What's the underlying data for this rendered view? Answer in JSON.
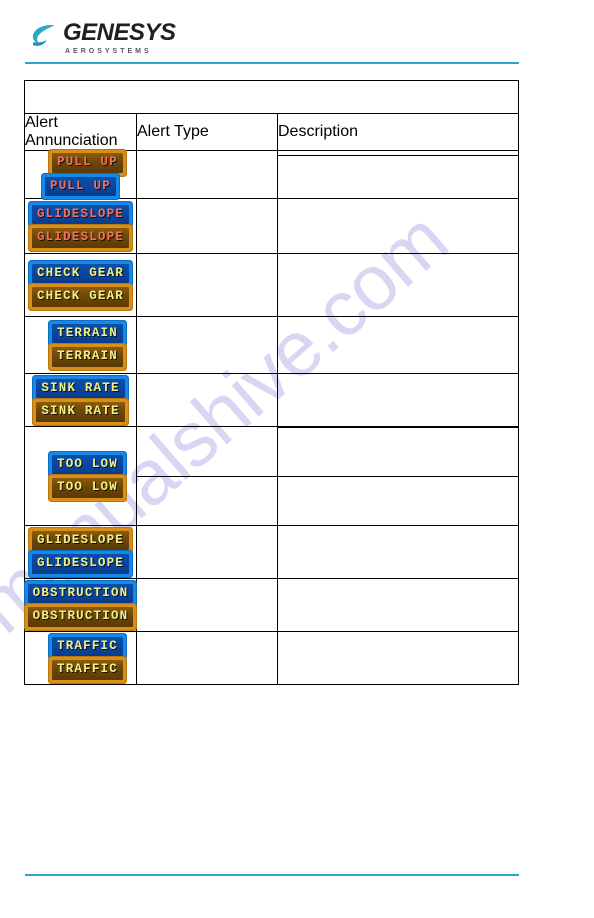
{
  "document": {
    "page_background": "#ffffff",
    "rule_color": "#29a8c9",
    "watermark_text": "manualshive.com"
  },
  "header": {
    "logo_name": "GENESYS",
    "logo_subtitle": "AEROSYSTEMS",
    "logo_icon": "swoosh-icon"
  },
  "table": {
    "columns": [
      "Alert Annunciation",
      "Alert Type",
      "Description"
    ],
    "header_row_label": "",
    "rows": [
      {
        "id": "pull-up",
        "badges": [
          {
            "text": "PULL UP",
            "style": "amber",
            "text_color": "#f2705e"
          },
          {
            "text": "PULL UP",
            "style": "blue",
            "text_color": "#f2705e"
          }
        ],
        "cells": [
          "",
          ""
        ]
      },
      {
        "id": "glideslope-1",
        "badges": [
          {
            "text": "GLIDESLOPE",
            "style": "blue",
            "text_color": "#f2705e"
          },
          {
            "text": "GLIDESLOPE",
            "style": "amber",
            "text_color": "#f2705e"
          }
        ],
        "cells": [
          "",
          ""
        ]
      },
      {
        "id": "check-gear",
        "badges": [
          {
            "text": "CHECK GEAR",
            "style": "blue",
            "text_color": "#f2ef86"
          },
          {
            "text": "CHECK GEAR",
            "style": "amber",
            "text_color": "#f2ef86"
          }
        ],
        "cells": [
          "",
          ""
        ]
      },
      {
        "id": "terrain",
        "badges": [
          {
            "text": "TERRAIN",
            "style": "blue",
            "text_color": "#f2ef86"
          },
          {
            "text": "TERRAIN",
            "style": "amber",
            "text_color": "#f2ef86"
          }
        ],
        "cells": [
          "",
          ""
        ]
      },
      {
        "id": "sink-rate",
        "badges": [
          {
            "text": "SINK RATE",
            "style": "blue",
            "text_color": "#f2ef86"
          },
          {
            "text": "SINK RATE",
            "style": "amber",
            "text_color": "#f2ef86"
          }
        ],
        "cells": [
          "",
          ""
        ]
      },
      {
        "id": "too-low",
        "badges": [
          {
            "text": "TOO LOW",
            "style": "blue",
            "text_color": "#f2ef86"
          },
          {
            "text": "TOO LOW",
            "style": "amber",
            "text_color": "#f2ef86"
          }
        ],
        "cells": [
          "",
          "",
          "",
          ""
        ]
      },
      {
        "id": "glideslope-2",
        "badges": [
          {
            "text": "GLIDESLOPE",
            "style": "amber",
            "text_color": "#f2ef86"
          },
          {
            "text": "GLIDESLOPE",
            "style": "blue",
            "text_color": "#f2ef86"
          }
        ],
        "cells": [
          "",
          ""
        ]
      },
      {
        "id": "obstruction",
        "badges": [
          {
            "text": "OBSTRUCTION",
            "style": "blue",
            "text_color": "#f2ef86"
          },
          {
            "text": "OBSTRUCTION",
            "style": "amber",
            "text_color": "#f2ef86"
          }
        ],
        "cells": [
          "",
          ""
        ]
      },
      {
        "id": "traffic",
        "badges": [
          {
            "text": "TRAFFIC",
            "style": "blue",
            "text_color": "#f2ef86"
          },
          {
            "text": "TRAFFIC",
            "style": "amber",
            "text_color": "#f2ef86"
          }
        ],
        "cells": [
          "",
          ""
        ]
      }
    ]
  }
}
